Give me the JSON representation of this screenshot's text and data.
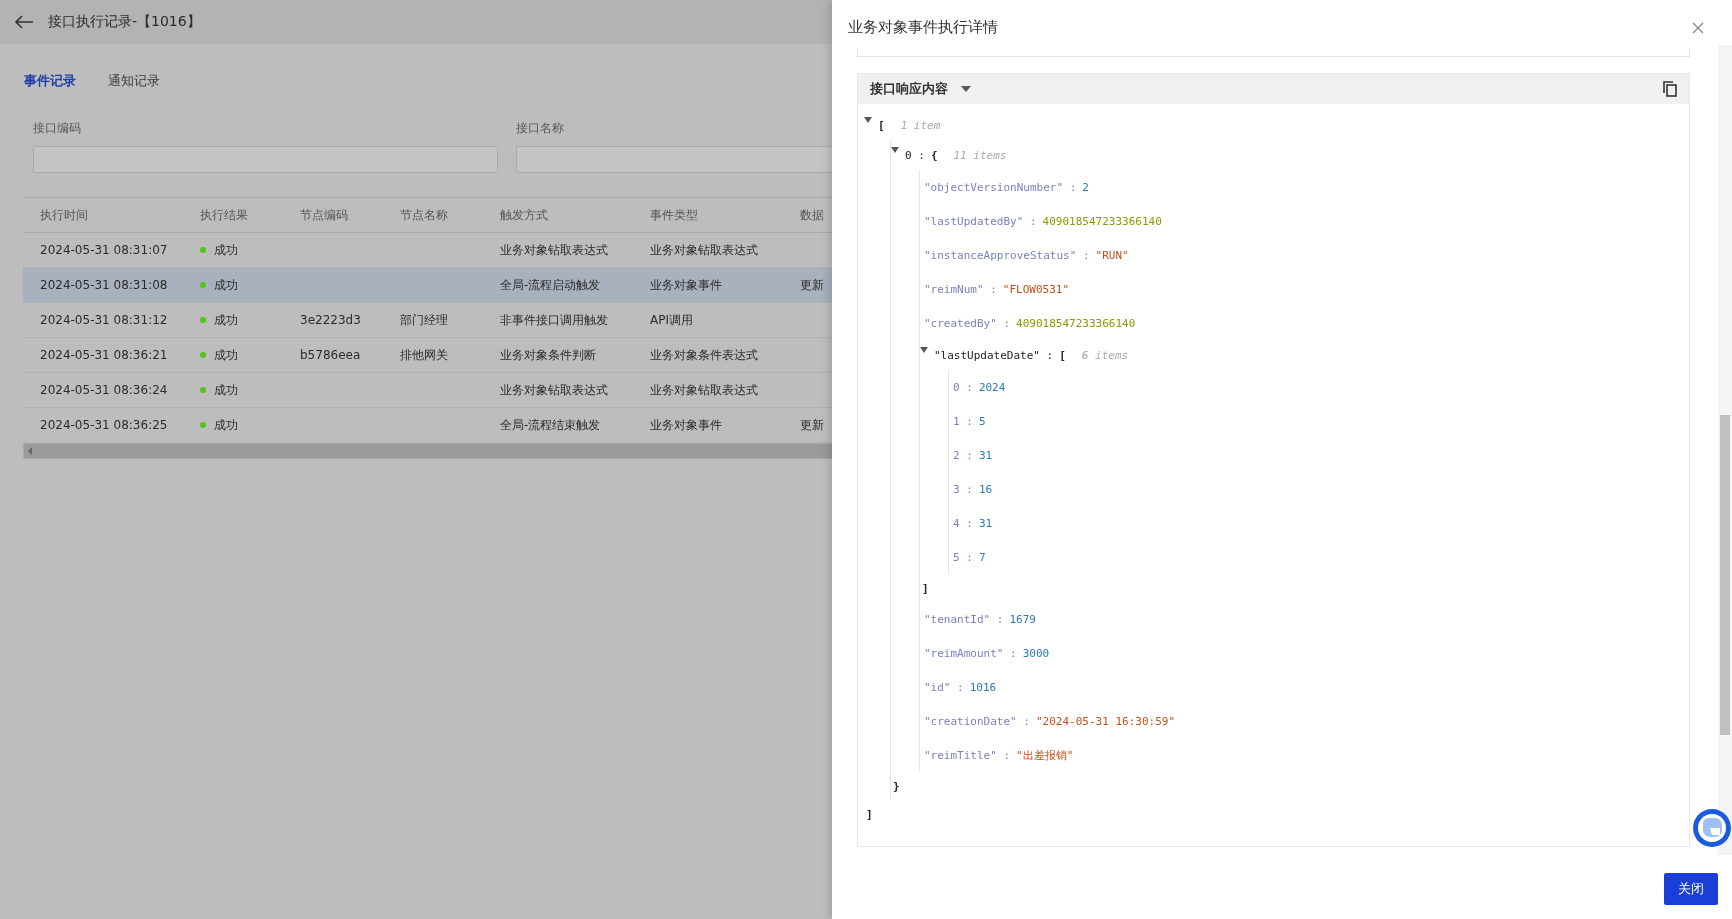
{
  "page": {
    "title": "接口执行记录-【1016】"
  },
  "tabs": [
    {
      "label": "事件记录",
      "selected": true
    },
    {
      "label": "通知记录",
      "selected": false
    }
  ],
  "filters": [
    {
      "label": "接口编码"
    },
    {
      "label": "接口名称"
    }
  ],
  "table": {
    "columns": [
      "执行时间",
      "执行结果",
      "节点编码",
      "节点名称",
      "触发方式",
      "事件类型",
      "数据"
    ],
    "rows": [
      {
        "time": "2024-05-31 08:31:07",
        "result": "成功",
        "color": "#52c41a",
        "node_code": "",
        "node_name": "",
        "trigger": "业务对象钻取表达式",
        "event_type": "业务对象钻取表达式",
        "data": "",
        "selected": false
      },
      {
        "time": "2024-05-31 08:31:08",
        "result": "成功",
        "color": "#52c41a",
        "node_code": "",
        "node_name": "",
        "trigger": "全局-流程启动触发",
        "event_type": "业务对象事件",
        "data": "更新",
        "selected": true
      },
      {
        "time": "2024-05-31 08:31:12",
        "result": "成功",
        "color": "#52c41a",
        "node_code": "3e2223d3",
        "node_name": "部门经理",
        "trigger": "非事件接口调用触发",
        "event_type": "API调用",
        "data": "",
        "selected": false
      },
      {
        "time": "2024-05-31 08:36:21",
        "result": "成功",
        "color": "#52c41a",
        "node_code": "b5786eea",
        "node_name": "排他网关",
        "trigger": "业务对象条件判断",
        "event_type": "业务对象条件表达式",
        "data": "",
        "selected": false
      },
      {
        "time": "2024-05-31 08:36:24",
        "result": "成功",
        "color": "#52c41a",
        "node_code": "",
        "node_name": "",
        "trigger": "业务对象钻取表达式",
        "event_type": "业务对象钻取表达式",
        "data": "",
        "selected": false
      },
      {
        "time": "2024-05-31 08:36:25",
        "result": "成功",
        "color": "#52c41a",
        "node_code": "",
        "node_name": "",
        "trigger": "全局-流程结束触发",
        "event_type": "业务对象事件",
        "data": "更新",
        "selected": false
      }
    ]
  },
  "drawer": {
    "title": "业务对象事件执行详情",
    "section": {
      "title": "接口响应内容",
      "expanded": true
    },
    "json": {
      "kind": "array",
      "open": "[",
      "close": "]",
      "count": "1 item",
      "expanded": true,
      "children": [
        {
          "key": "0 :",
          "kind": "object",
          "open": "{",
          "close": "}",
          "count": "11 items",
          "expanded": true,
          "children": [
            {
              "key": "\"objectVersionNumber\" :",
              "kind": "number",
              "value": "2"
            },
            {
              "key": "\"lastUpdatedBy\" :",
              "kind": "long",
              "value": "409018547233366140"
            },
            {
              "key": "\"instanceApproveStatus\" :",
              "kind": "string",
              "value": "\"RUN\""
            },
            {
              "key": "\"reimNum\" :",
              "kind": "string",
              "value": "\"FLOW0531\""
            },
            {
              "key": "\"createdBy\" :",
              "kind": "long",
              "value": "409018547233366140"
            },
            {
              "key": "\"lastUpdateDate\" :",
              "kind": "array",
              "open": "[",
              "close": "]",
              "count": "6 items",
              "expanded": true,
              "children": [
                {
                  "key": "0 :",
                  "kind": "number",
                  "value": "2024"
                },
                {
                  "key": "1 :",
                  "kind": "number",
                  "value": "5"
                },
                {
                  "key": "2 :",
                  "kind": "number",
                  "value": "31"
                },
                {
                  "key": "3 :",
                  "kind": "number",
                  "value": "16"
                },
                {
                  "key": "4 :",
                  "kind": "number",
                  "value": "31"
                },
                {
                  "key": "5 :",
                  "kind": "number",
                  "value": "7"
                }
              ]
            },
            {
              "key": "\"tenantId\" :",
              "kind": "number",
              "value": "1679"
            },
            {
              "key": "\"reimAmount\" :",
              "kind": "number",
              "value": "3000"
            },
            {
              "key": "\"id\" :",
              "kind": "number",
              "value": "1016"
            },
            {
              "key": "\"creationDate\" :",
              "kind": "string",
              "value": "\"2024-05-31 16:30:59\""
            },
            {
              "key": "\"reimTitle\" :",
              "kind": "string",
              "value": "\"出差报销\""
            }
          ]
        }
      ]
    },
    "buttons": [
      {
        "label": "关闭"
      }
    ]
  }
}
